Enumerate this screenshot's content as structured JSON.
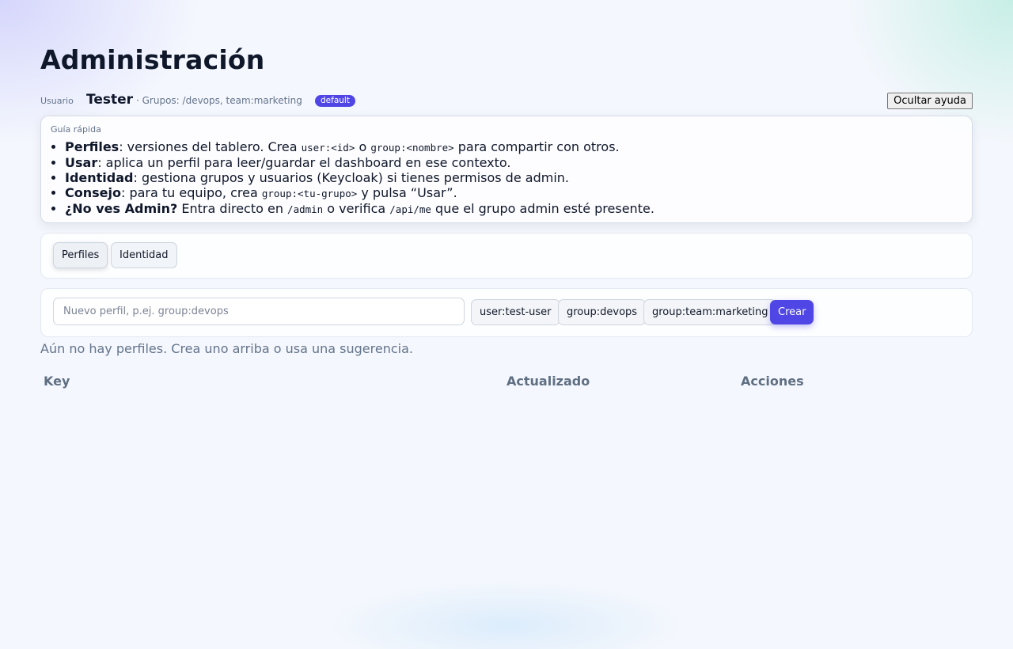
{
  "header": {
    "title": "Administración"
  },
  "user": {
    "label": "Usuario",
    "name": "Tester",
    "groups_text": "· Grupos: /devops, team:marketing",
    "profile_badge": "default",
    "toggle_help_label": "Ocultar ayuda"
  },
  "guide": {
    "title": "Guía rápida",
    "items": [
      {
        "term": "Perfiles",
        "text_a": ": versiones del tablero. Crea ",
        "code_a": "user:<id>",
        "text_b": " o ",
        "code_b": "group:<nombre>",
        "text_c": " para compartir con otros."
      },
      {
        "term": "Usar",
        "text_a": ": aplica un perfil para leer/guardar el dashboard en ese contexto."
      },
      {
        "term": "Identidad",
        "text_a": ": gestiona grupos y usuarios (Keycloak) si tienes permisos de admin."
      },
      {
        "term": "Consejo",
        "text_a": ": para tu equipo, crea ",
        "code_a": "group:<tu-grupo>",
        "text_b": " y pulsa “Usar”."
      },
      {
        "term": "¿No ves Admin?",
        "text_a": " Entra directo en ",
        "code_a": "/admin",
        "text_b": " o verifica ",
        "code_b": "/api/me",
        "text_c": " que el grupo admin esté presente."
      }
    ]
  },
  "tabs": [
    {
      "label": "Perfiles",
      "active": true
    },
    {
      "label": "Identidad",
      "active": false
    }
  ],
  "create": {
    "placeholder": "Nuevo perfil, p.ej. group:devops",
    "value": "",
    "suggestions": [
      "user:test-user",
      "group:devops",
      "group:team:marketing"
    ],
    "create_label": "Crear"
  },
  "empty_message": "Aún no hay perfiles. Crea uno arriba o usa una sugerencia.",
  "table": {
    "columns": [
      "Key",
      "Actualizado",
      "Acciones"
    ],
    "rows": []
  },
  "colors": {
    "accent": "#4f46e5",
    "text": "#0f172a",
    "muted": "#64748b",
    "column_header": "#5f6f82"
  }
}
